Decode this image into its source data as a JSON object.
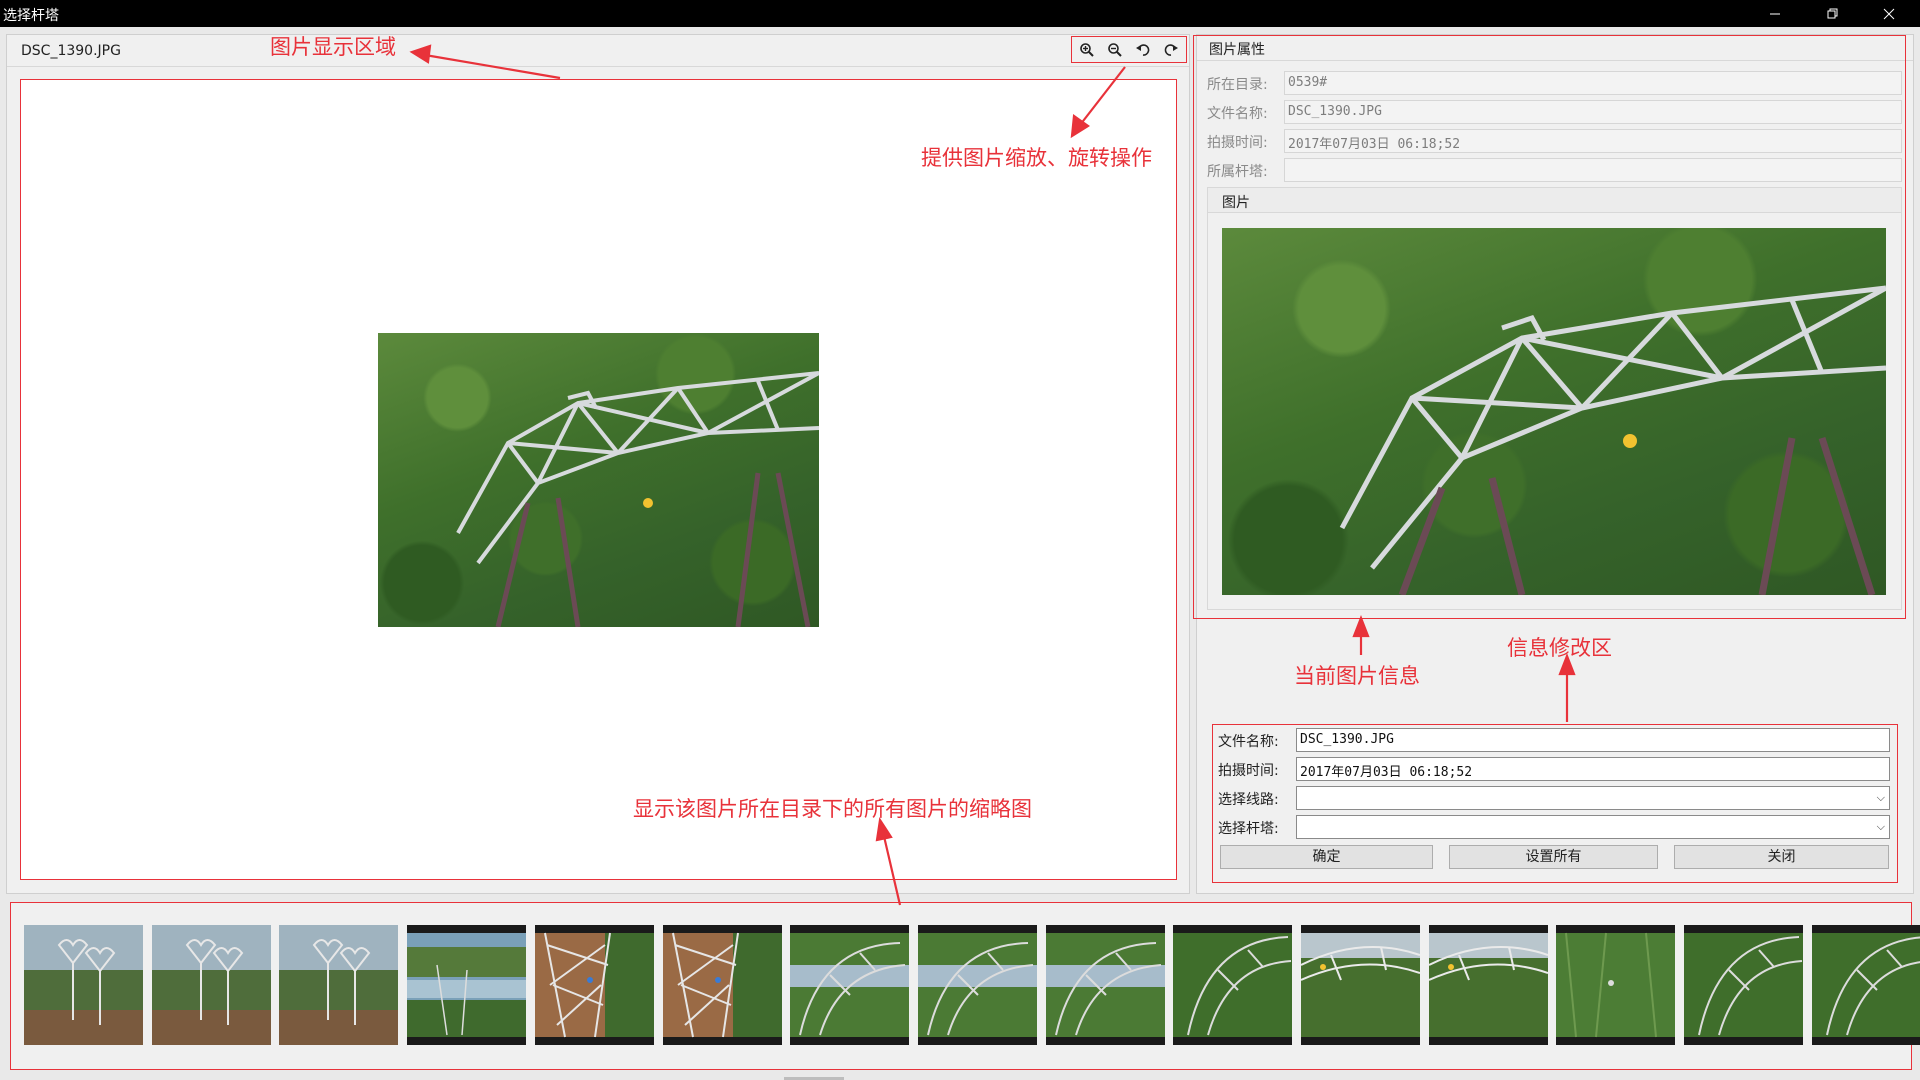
{
  "window": {
    "title": "选择杆塔",
    "minimize_icon": "minimize-icon",
    "restore_icon": "restore-icon",
    "close_icon": "close-icon"
  },
  "viewer": {
    "filename": "DSC_1390.JPG",
    "tools": [
      "zoom-in-icon",
      "zoom-out-icon",
      "rotate-left-icon",
      "rotate-right-icon"
    ]
  },
  "properties": {
    "header": "图片属性",
    "fields": [
      {
        "label": "所在目录:",
        "value": "0539#"
      },
      {
        "label": "文件名称:",
        "value": "DSC_1390.JPG"
      },
      {
        "label": "拍摄时间:",
        "value": "2017年07月03日 06:18;52"
      },
      {
        "label": "所属杆塔:",
        "value": ""
      }
    ],
    "image_header": "图片"
  },
  "edit": {
    "filename_label": "文件名称:",
    "filename_value": "DSC_1390.JPG",
    "time_label": "拍摄时间:",
    "time_value": "2017年07月03日 06:18;52",
    "line_label": "选择线路:",
    "line_value": "",
    "tower_label": "选择杆塔:",
    "tower_value": "",
    "confirm": "确定",
    "set_all": "设置所有",
    "close": "关闭"
  },
  "annotations": {
    "display_area": "图片显示区域",
    "zoom_rotate": "提供图片缩放、旋转操作",
    "current_info": "当前图片信息",
    "edit_area": "信息修改区",
    "thumbnails": "显示该图片所在目录下的所有图片的缩略图"
  },
  "thumbnails": [
    {
      "kind": "heart-tower"
    },
    {
      "kind": "heart-tower"
    },
    {
      "kind": "heart-tower"
    },
    {
      "kind": "river"
    },
    {
      "kind": "lattice-close"
    },
    {
      "kind": "lattice-close"
    },
    {
      "kind": "arch-river"
    },
    {
      "kind": "arch-river"
    },
    {
      "kind": "arch-river"
    },
    {
      "kind": "arch"
    },
    {
      "kind": "arch-bright"
    },
    {
      "kind": "arch-bright"
    },
    {
      "kind": "forest"
    },
    {
      "kind": "arch"
    },
    {
      "kind": "arch"
    }
  ],
  "colors": {
    "annotation_red": "#e8323a",
    "titlebar": "#000000"
  }
}
